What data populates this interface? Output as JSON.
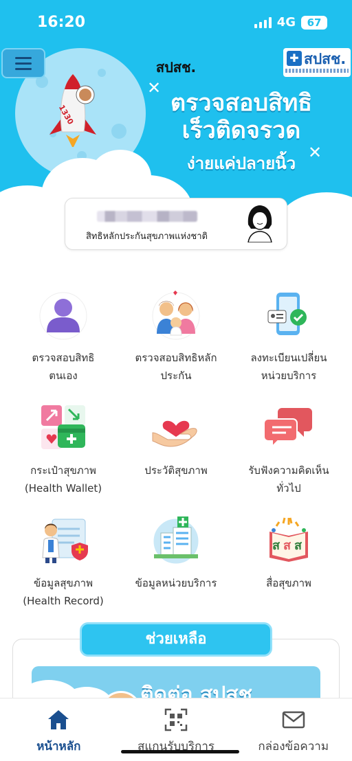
{
  "status_bar": {
    "time": "16:20",
    "network": "4G",
    "battery": "67"
  },
  "header": {
    "title": "สปสช.",
    "logo_text": "สปสช.",
    "menu_icon": "hamburger-icon"
  },
  "hero": {
    "headline_line1": "ตรวจสอบสิทธิ",
    "headline_line2": "เร็วติดจรวด",
    "subline": "ง่ายแค่ปลายนิ้ว",
    "rocket_number": "1330"
  },
  "profile": {
    "rights_label": "สิทธิหลักประกันสุขภาพแห่งชาติ"
  },
  "menu": [
    {
      "line1": "ตรวจสอบสิทธิ",
      "line2": "ตนเอง",
      "icon": "person-icon"
    },
    {
      "line1": "ตรวจสอบสิทธิหลัก",
      "line2": "ประกัน",
      "icon": "family-icon"
    },
    {
      "line1": "ลงทะเบียนเปลี่ยน",
      "line2": "หน่วยบริการ",
      "icon": "phone-check-icon"
    },
    {
      "line1": "กระเป๋าสุขภาพ",
      "line2": "(Health Wallet)",
      "icon": "health-wallet-icon"
    },
    {
      "line1": "ประวัติสุขภาพ",
      "line2": "",
      "icon": "heart-hand-icon"
    },
    {
      "line1": "รับฟังความคิดเห็น",
      "line2": "ทั่วไป",
      "icon": "chat-bubbles-icon"
    },
    {
      "line1": "ข้อมูลสุขภาพ",
      "line2": "(Health Record)",
      "icon": "doctor-record-icon"
    },
    {
      "line1": "ข้อมูลหน่วยบริการ",
      "line2": "",
      "icon": "hospital-icon"
    },
    {
      "line1": "สื่อสุขภาพ",
      "line2": "",
      "icon": "health-media-book-icon"
    }
  ],
  "help": {
    "button_label": "ช่วยเหลือ",
    "banner_text": "ติดต่อ สปสช"
  },
  "nav": [
    {
      "label": "หน้าหลัก",
      "icon": "home-icon",
      "active": true
    },
    {
      "label": "สแกนรับบริการ",
      "icon": "qr-scan-icon",
      "active": false
    },
    {
      "label": "กล่องข้อความ",
      "icon": "mail-icon",
      "active": false
    }
  ],
  "colors": {
    "sky": "#1fc0ee",
    "accent": "#2ec4f0",
    "nav_active": "#1a4f8f"
  }
}
